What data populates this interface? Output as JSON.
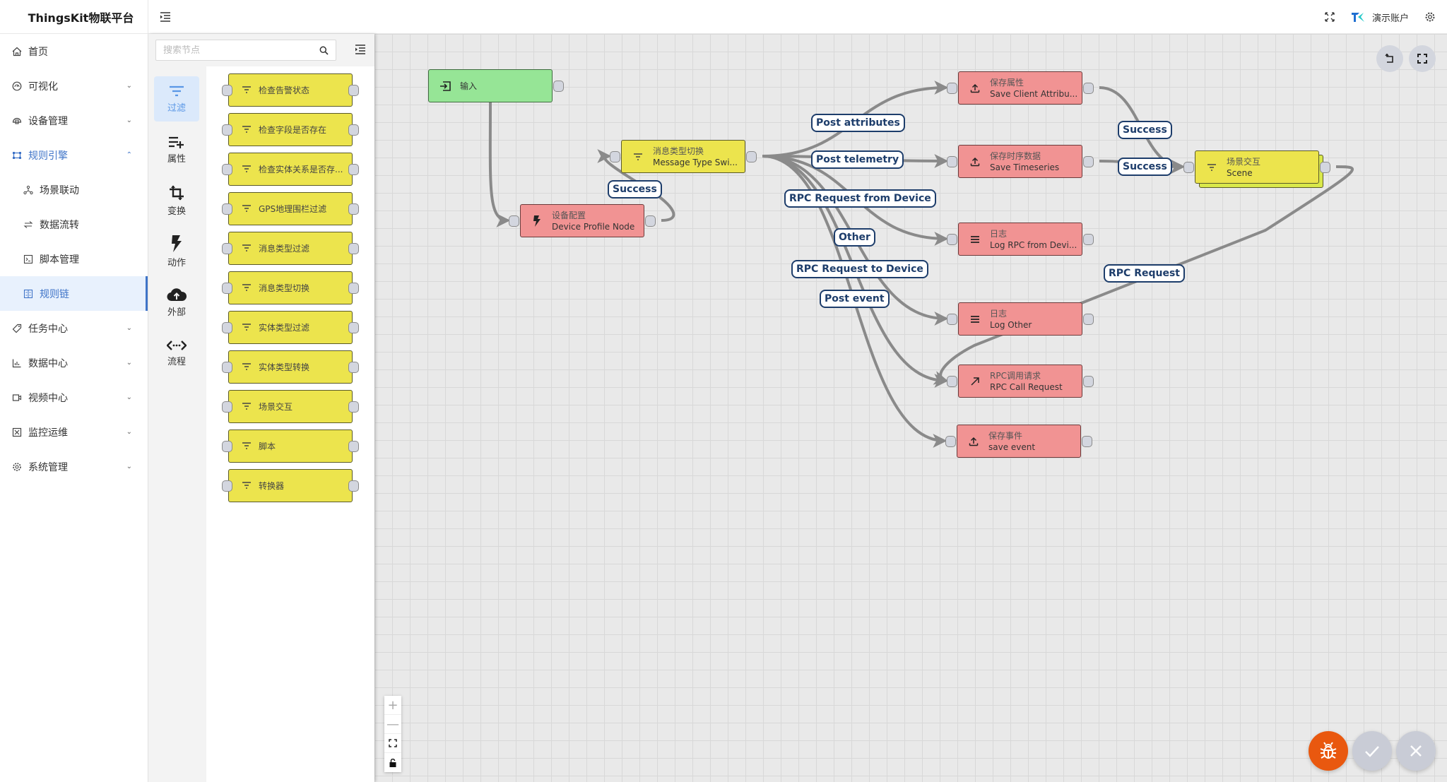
{
  "app": {
    "title": "ThingsKit物联平台"
  },
  "sidebar": {
    "items": [
      {
        "label": "首页",
        "icon": "home-icon"
      },
      {
        "label": "可视化",
        "icon": "dashboard-icon",
        "expandable": true
      },
      {
        "label": "设备管理",
        "icon": "device-icon",
        "expandable": true
      },
      {
        "label": "规则引擎",
        "icon": "rule-engine-icon",
        "expandable": true,
        "open": true,
        "children": [
          {
            "label": "场景联动",
            "icon": "scene-icon"
          },
          {
            "label": "数据流转",
            "icon": "flow-icon"
          },
          {
            "label": "脚本管理",
            "icon": "script-icon"
          },
          {
            "label": "规则链",
            "icon": "rule-chain-icon",
            "active": true
          }
        ]
      },
      {
        "label": "任务中心",
        "icon": "tag-icon",
        "expandable": true
      },
      {
        "label": "数据中心",
        "icon": "chart-icon",
        "expandable": true
      },
      {
        "label": "视频中心",
        "icon": "video-icon",
        "expandable": true
      },
      {
        "label": "监控运维",
        "icon": "monitor-icon",
        "expandable": true
      },
      {
        "label": "系统管理",
        "icon": "gear-icon",
        "expandable": true
      }
    ]
  },
  "header": {
    "account_name": "演示账户",
    "brand_badge": "TK"
  },
  "palette": {
    "search_placeholder": "搜索节点",
    "search_value": "",
    "categories": [
      {
        "label": "过滤",
        "icon": "filter-icon",
        "active": true
      },
      {
        "label": "属性",
        "icon": "attribute-add-icon"
      },
      {
        "label": "变换",
        "icon": "transform-icon"
      },
      {
        "label": "动作",
        "icon": "lightning-icon"
      },
      {
        "label": "外部",
        "icon": "cloud-upload-icon"
      },
      {
        "label": "流程",
        "icon": "flow-code-icon"
      }
    ],
    "nodes": [
      "检查告警状态",
      "检查字段是否存在",
      "检查实体关系是否存...",
      "GPS地理围栏过滤",
      "消息类型过滤",
      "消息类型切换",
      "实体类型过滤",
      "实体类型转换",
      "场景交互",
      "脚本",
      "转换器"
    ]
  },
  "canvas": {
    "nodes": [
      {
        "id": "input",
        "title": "输入",
        "subtitle": "",
        "kind": "green",
        "icon": "input-icon"
      },
      {
        "id": "device_profile",
        "title": "设备配置",
        "subtitle": "Device Profile Node",
        "kind": "red",
        "icon": "lightning-icon"
      },
      {
        "id": "msg_switch",
        "title": "消息类型切换",
        "subtitle": "Message Type Swi...",
        "kind": "yellow",
        "icon": "filter-icon"
      },
      {
        "id": "save_attr",
        "title": "保存属性",
        "subtitle": "Save Client Attribu...",
        "kind": "red",
        "icon": "upload-icon"
      },
      {
        "id": "save_ts",
        "title": "保存时序数据",
        "subtitle": "Save Timeseries",
        "kind": "red",
        "icon": "upload-icon"
      },
      {
        "id": "log_rpc",
        "title": "日志",
        "subtitle": "Log RPC from Devi...",
        "kind": "red",
        "icon": "menu-lines-icon"
      },
      {
        "id": "log_other",
        "title": "日志",
        "subtitle": "Log Other",
        "kind": "red",
        "icon": "menu-lines-icon"
      },
      {
        "id": "rpc_call",
        "title": "RPC调用请求",
        "subtitle": "RPC Call Request",
        "kind": "red",
        "icon": "arrow-up-right-icon"
      },
      {
        "id": "save_event",
        "title": "保存事件",
        "subtitle": "save event",
        "kind": "red",
        "icon": "upload-icon"
      },
      {
        "id": "scene",
        "title": "场景交互",
        "subtitle": "Scene",
        "kind": "yellow",
        "icon": "filter-icon"
      }
    ],
    "edges": [
      {
        "from": "input",
        "to": "device_profile",
        "label": ""
      },
      {
        "from": "device_profile",
        "to": "msg_switch",
        "label": "Success"
      },
      {
        "from": "msg_switch",
        "to": "save_attr",
        "label": "Post attributes"
      },
      {
        "from": "msg_switch",
        "to": "save_ts",
        "label": "Post telemetry"
      },
      {
        "from": "msg_switch",
        "to": "log_rpc",
        "label": "RPC Request from Device"
      },
      {
        "from": "msg_switch",
        "to": "log_other",
        "label": "Other"
      },
      {
        "from": "msg_switch",
        "to": "rpc_call",
        "label": "RPC Request to Device"
      },
      {
        "from": "msg_switch",
        "to": "save_event",
        "label": "Post event"
      },
      {
        "from": "save_attr",
        "to": "scene",
        "label": "Success"
      },
      {
        "from": "save_ts",
        "to": "scene",
        "label": "Success"
      },
      {
        "from": "scene",
        "to": "rpc_call",
        "label": "RPC Request"
      }
    ]
  },
  "colors": {
    "accent": "#3f74c8",
    "node_red": "#f19393",
    "node_yellow": "#ece44d",
    "node_green": "#96e596",
    "edge_label": "#1d3d6b",
    "debug_button": "#e9580f"
  }
}
